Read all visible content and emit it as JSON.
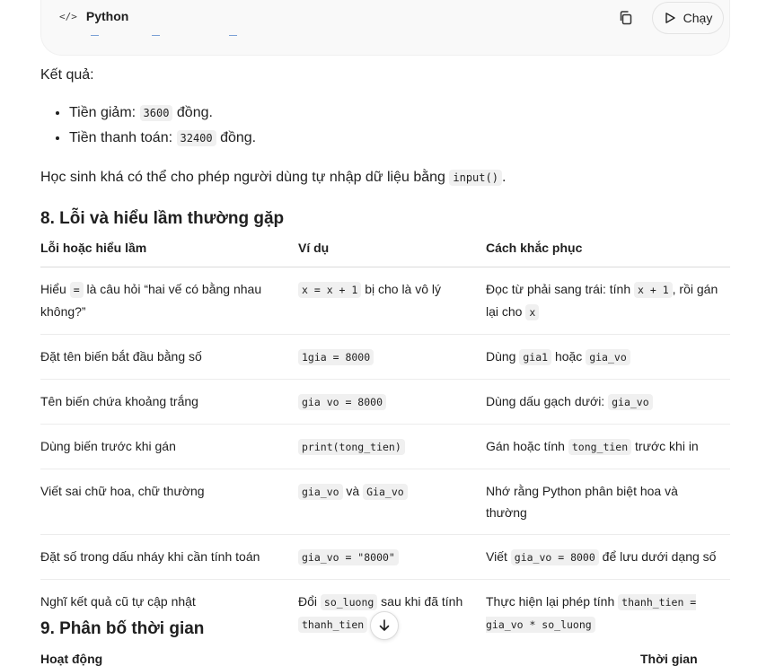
{
  "code_block": {
    "language": "Python",
    "copy_icon": "copy-icon",
    "run_label": "Chạy"
  },
  "result": {
    "heading": "Kết quả:",
    "items": [
      {
        "prefix": "Tiền giảm: ",
        "code": "3600",
        "suffix": " đồng."
      },
      {
        "prefix": "Tiền thanh toán: ",
        "code": "32400",
        "suffix": " đồng."
      }
    ],
    "note_prefix": "Học sinh khá có thể cho phép người dùng tự nhập dữ liệu bằng ",
    "note_code": "input()",
    "note_suffix": "."
  },
  "section8": {
    "title": "8. Lỗi và hiểu lầm thường gặp",
    "headers": [
      "Lỗi hoặc hiểu lầm",
      "Ví dụ",
      "Cách khắc phục"
    ],
    "rows": [
      {
        "c1": [
          "Hiểu ",
          {
            "code": "="
          },
          " là câu hỏi “hai vế có bằng nhau không?”"
        ],
        "c2": [
          {
            "code": "x = x + 1"
          },
          " bị cho là vô lý"
        ],
        "c3": [
          "Đọc từ phải sang trái: tính ",
          {
            "code": "x + 1"
          },
          ", rồi gán lại cho ",
          {
            "code": "x"
          }
        ]
      },
      {
        "c1": [
          "Đặt tên biến bắt đầu bằng số"
        ],
        "c2": [
          {
            "code": "1gia = 8000"
          }
        ],
        "c3": [
          "Dùng ",
          {
            "code": "gia1"
          },
          " hoặc ",
          {
            "code": "gia_vo"
          }
        ]
      },
      {
        "c1": [
          "Tên biến chứa khoảng trắng"
        ],
        "c2": [
          {
            "code": "gia vo = 8000"
          }
        ],
        "c3": [
          "Dùng dấu gạch dưới: ",
          {
            "code": "gia_vo"
          }
        ]
      },
      {
        "c1": [
          "Dùng biến trước khi gán"
        ],
        "c2": [
          {
            "code": "print(tong_tien)"
          }
        ],
        "c3": [
          "Gán hoặc tính ",
          {
            "code": "tong_tien"
          },
          " trước khi in"
        ]
      },
      {
        "c1": [
          "Viết sai chữ hoa, chữ thường"
        ],
        "c2": [
          {
            "code": "gia_vo"
          },
          " và ",
          {
            "code": "Gia_vo"
          }
        ],
        "c3": [
          "Nhớ rằng Python phân biệt hoa và thường"
        ]
      },
      {
        "c1": [
          "Đặt số trong dấu nháy khi cần tính toán"
        ],
        "c2": [
          {
            "code": "gia_vo = \"8000\""
          }
        ],
        "c3": [
          "Viết ",
          {
            "code": "gia_vo = 8000"
          },
          " để lưu dưới dạng số"
        ]
      },
      {
        "c1": [
          "Nghĩ kết quả cũ tự cập nhật"
        ],
        "c2": [
          "Đổi ",
          {
            "code": "so_luong"
          },
          " sau khi đã tính ",
          {
            "code": "thanh_tien"
          }
        ],
        "c3": [
          "Thực hiện lại phép tính ",
          {
            "code": "thanh_tien = gia_vo * so_luong"
          }
        ]
      }
    ]
  },
  "section9": {
    "title": "9. Phân bố thời gian",
    "headers": [
      "Hoạt động",
      "Thời gian"
    ]
  },
  "scroll_down_icon": "arrow-down-icon"
}
